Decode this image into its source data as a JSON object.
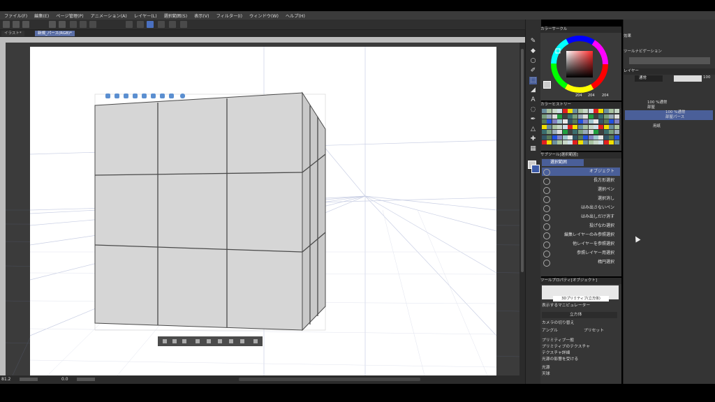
{
  "menu": [
    "ファイル(F)",
    "編集(E)",
    "ページ管理(P)",
    "アニメーション(A)",
    "レイヤー(L)",
    "選択範囲(S)",
    "表示(V)",
    "フィルター(I)",
    "ウィンドウ(W)",
    "ヘルプ(H)"
  ],
  "tabs": {
    "first": "イラスト*",
    "second": "新規_パース(RGB)*"
  },
  "status": {
    "zoom": "81.2",
    "angle": "0.0"
  },
  "color_circle": {
    "header": "カラーサークル",
    "h": "204",
    "s": "204",
    "v": "204"
  },
  "palette": {
    "header": "カラーヒストリー"
  },
  "subtool": {
    "header": "サブツール[選択範囲]",
    "group": "選択範囲",
    "items": [
      "オブジェクト",
      "長方形選択",
      "選択ペン",
      "選択消し",
      "はみ出さないペン",
      "はみ出しだけ消す",
      "投げなわ選択",
      "編集レイヤーのみ参照選択",
      "他レイヤーを参照選択",
      "参照レイヤー用選択",
      "楕円選択"
    ]
  },
  "tool_property": {
    "header": "ツールプロパティ[オブジェクト]",
    "object_name": "3Dプリミティブ(立方体)",
    "manipulator_label": "表示するマニピュレーター",
    "primitive": "立方体",
    "camera": "カメラの切り替え",
    "angle": "アングル",
    "preset": "プリセット",
    "items": [
      "プリミティブ一般",
      "プリミティブのテクスチャ",
      "テクスチャ詳細",
      "光源の影響を受ける",
      "光源",
      "天球"
    ]
  },
  "right": {
    "effects": "効果",
    "navigation": "ツールナビゲーション",
    "layer_header": "レイヤー",
    "blend": "通常",
    "opacity": "100",
    "layers": [
      {
        "pct": "100 %通常",
        "name": "部屋"
      },
      {
        "pct": "100 %通常",
        "name": "部屋パース"
      },
      {
        "pct": "",
        "name": "用紙"
      }
    ]
  }
}
